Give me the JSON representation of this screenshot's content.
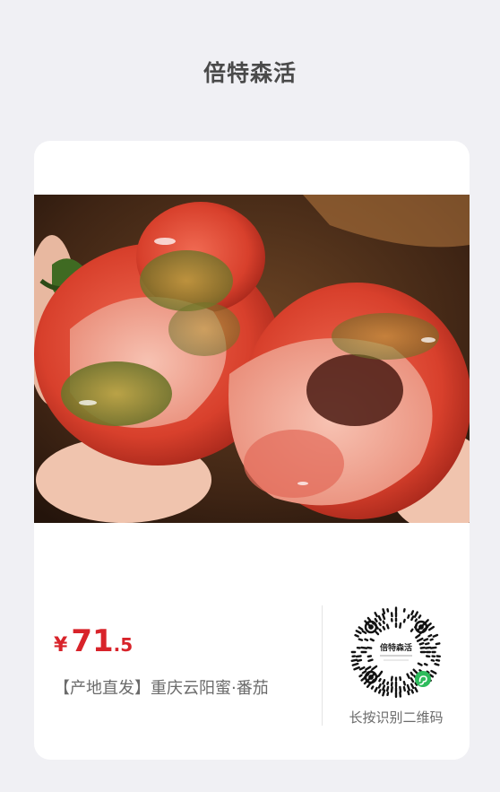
{
  "header": {
    "title": "倍特森活"
  },
  "product": {
    "image_icon": "tomato-photo",
    "price_symbol": "¥",
    "price_integer": "71",
    "price_decimal": ".5",
    "name": "【产地直发】重庆云阳蜜·番茄"
  },
  "qr": {
    "icon": "mini-program-qr-code",
    "brand_text": "倍特森活",
    "badge_icon": "wechat-mini-program-icon",
    "label": "长按识别二维码"
  },
  "colors": {
    "background": "#f0f0f4",
    "card": "#ffffff",
    "price": "#d8232a",
    "badge": "#2dbb5c"
  }
}
